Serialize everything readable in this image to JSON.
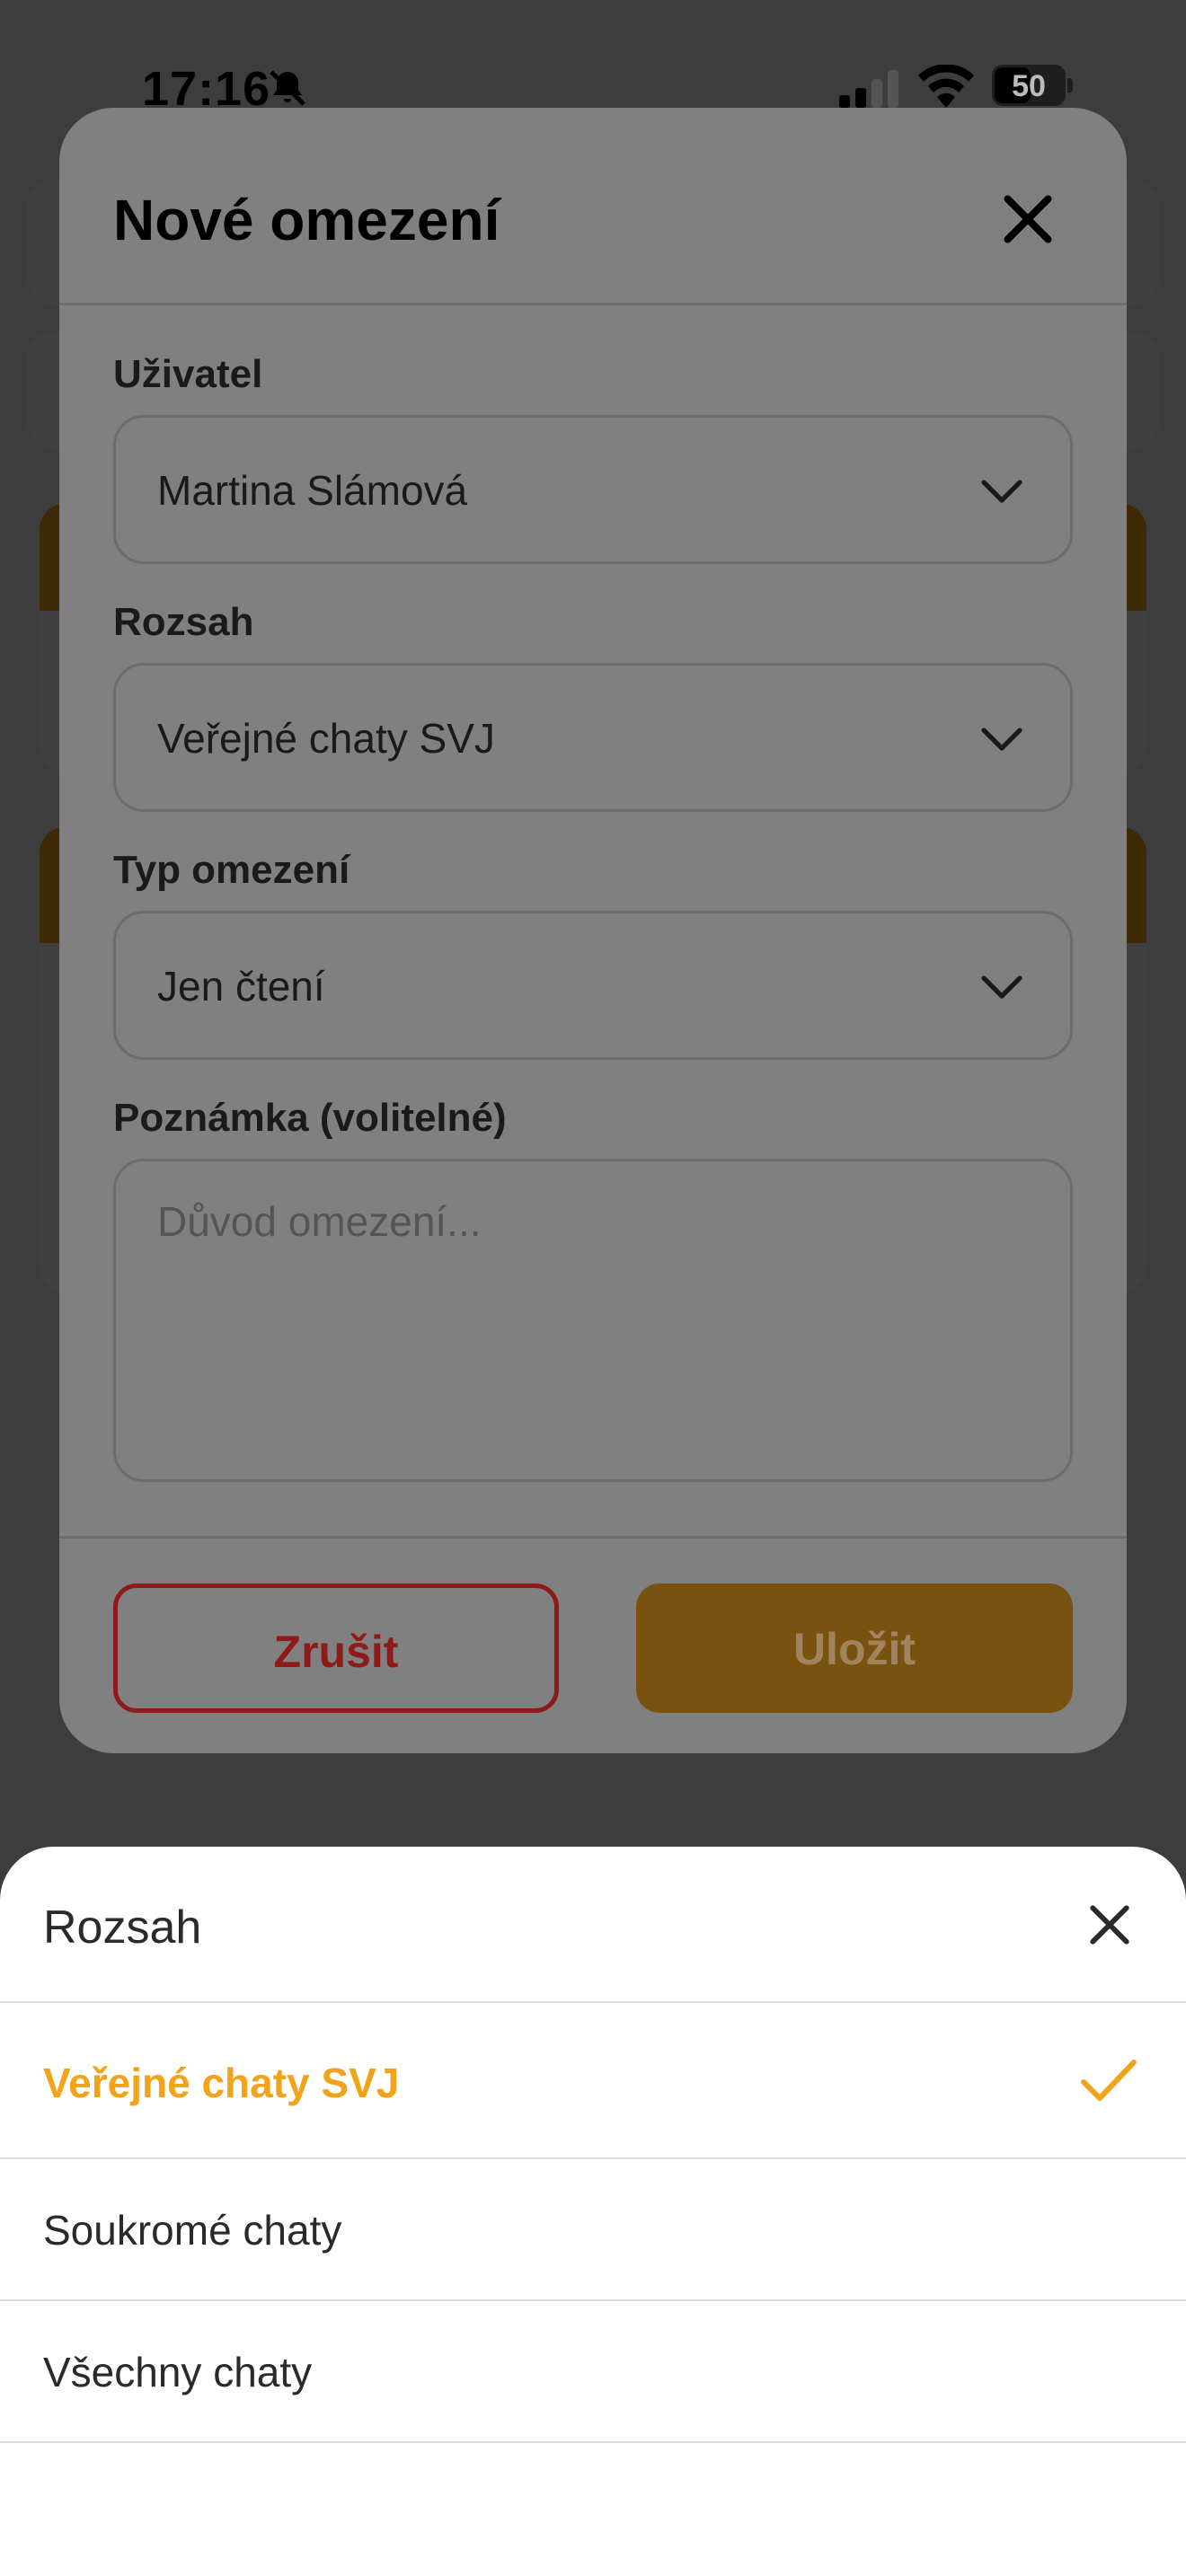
{
  "status_bar": {
    "time": "17:16",
    "battery": "50"
  },
  "modal": {
    "title": "Nové omezení",
    "fields": {
      "user": {
        "label": "Uživatel",
        "value": "Martina Slámová"
      },
      "scope": {
        "label": "Rozsah",
        "value": "Veřejné chaty SVJ"
      },
      "type": {
        "label": "Typ omezení",
        "value": "Jen čtení"
      },
      "note": {
        "label": "Poznámka (volitelné)",
        "placeholder": "Důvod omezení..."
      }
    },
    "buttons": {
      "cancel": "Zrušit",
      "save": "Uložit"
    }
  },
  "sheet": {
    "title": "Rozsah",
    "options": [
      {
        "label": "Veřejné chaty SVJ",
        "selected": true
      },
      {
        "label": "Soukromé chaty",
        "selected": false
      },
      {
        "label": "Všechny chaty",
        "selected": false
      }
    ]
  },
  "colors": {
    "accent": "#f2a31a",
    "cancel_red": "#8e1a1a",
    "save_dim": "#7a5210"
  },
  "icons": {
    "close": "close-icon",
    "chevron": "chevron-down-icon",
    "check": "checkmark-icon",
    "mute": "bell-slash-icon",
    "signal": "cellular-signal-icon",
    "wifi": "wifi-icon",
    "battery": "battery-icon"
  }
}
